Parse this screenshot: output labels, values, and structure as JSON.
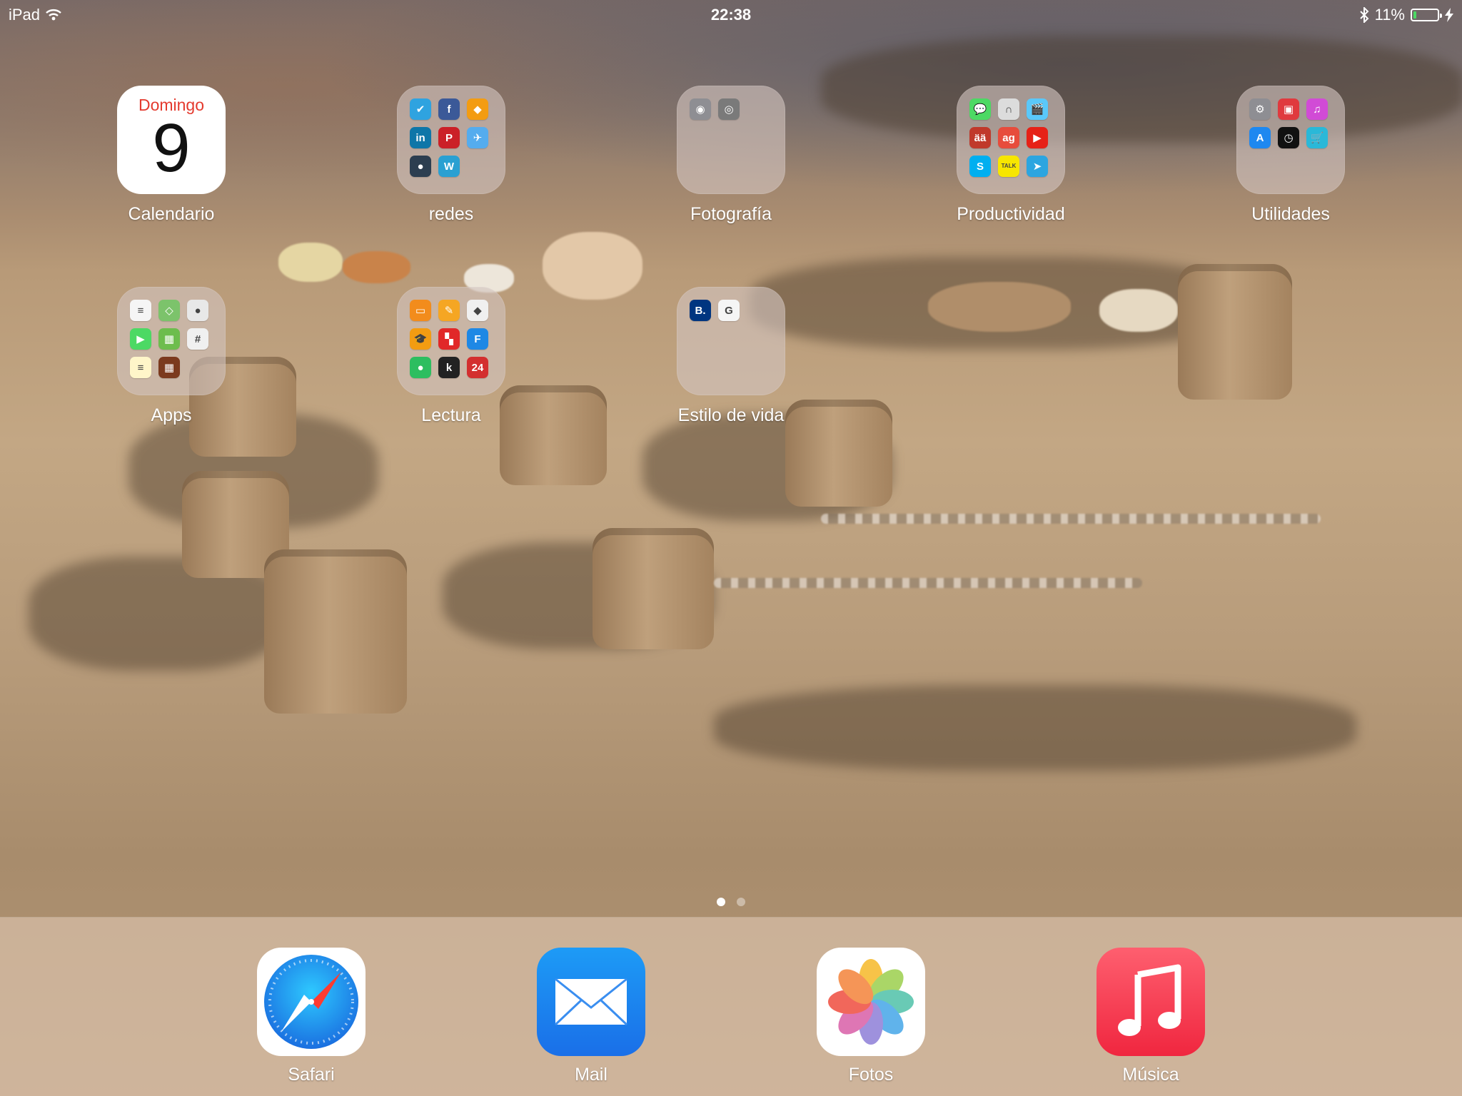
{
  "status_bar": {
    "device": "iPad",
    "time": "22:38",
    "battery_percent": "11%",
    "battery_level": 0.11,
    "icons": [
      "wifi-icon",
      "bluetooth-icon",
      "battery-icon",
      "charging-bolt-icon"
    ]
  },
  "home": {
    "row1": {
      "calendar": {
        "label": "Calendario",
        "weekday": "Domingo",
        "day": "9"
      },
      "redes": {
        "label": "redes"
      },
      "fotografia": {
        "label": "Fotografía"
      },
      "productividad": {
        "label": "Productividad"
      },
      "utilidades": {
        "label": "Utilidades"
      }
    },
    "row2": {
      "apps": {
        "label": "Apps"
      },
      "lectura": {
        "label": "Lectura"
      },
      "estilo": {
        "label": "Estilo de vida"
      }
    }
  },
  "folder_apps": {
    "redes": [
      {
        "icon": "tasks-app-icon",
        "color": "#2fa3e0",
        "glyph": "✔"
      },
      {
        "icon": "facebook-icon",
        "color": "#3b5998",
        "glyph": "f"
      },
      {
        "icon": "orange-app-icon",
        "color": "#f39c12",
        "glyph": "◆"
      },
      {
        "icon": "linkedin-icon",
        "color": "#0e76a8",
        "glyph": "in"
      },
      {
        "icon": "pinterest-icon",
        "color": "#cb2027",
        "glyph": "P"
      },
      {
        "icon": "twitter-icon",
        "color": "#55acee",
        "glyph": "✈"
      },
      {
        "icon": "tapbots-icon",
        "color": "#2c3e50",
        "glyph": "●"
      },
      {
        "icon": "wordpress-icon",
        "color": "#2aa0d2",
        "glyph": "W"
      }
    ],
    "fotografia": [
      {
        "icon": "camera-icon",
        "color": "#8e8e93",
        "glyph": "◉"
      },
      {
        "icon": "photo-booth-icon",
        "color": "#7a7a7a",
        "glyph": "◎"
      }
    ],
    "productividad": [
      {
        "icon": "messages-icon",
        "color": "#4cd964",
        "glyph": "💬"
      },
      {
        "icon": "headphones-app-icon",
        "color": "#dcdcdc",
        "glyph": "∩"
      },
      {
        "icon": "clapperboard-icon",
        "color": "#5ac8fa",
        "glyph": "🎬"
      },
      {
        "icon": "keyboard-app-icon",
        "color": "#c0392b",
        "glyph": "ää"
      },
      {
        "icon": "app-gratis-icon",
        "color": "#e74c3c",
        "glyph": "ag"
      },
      {
        "icon": "youtube-icon",
        "color": "#e62117",
        "glyph": "▶"
      },
      {
        "icon": "skype-icon",
        "color": "#00aff0",
        "glyph": "S"
      },
      {
        "icon": "kakaotalk-icon",
        "color": "#f7e600",
        "glyph": "TALK"
      },
      {
        "icon": "telegram-icon",
        "color": "#2ca5e0",
        "glyph": "➤"
      }
    ],
    "utilidades": [
      {
        "icon": "settings-icon",
        "color": "#8e8e93",
        "glyph": "⚙"
      },
      {
        "icon": "red-app-icon",
        "color": "#e03a3e",
        "glyph": "▣"
      },
      {
        "icon": "itunes-store-icon",
        "color": "#d14bd6",
        "glyph": "♫"
      },
      {
        "icon": "app-store-icon",
        "color": "#1e88f0",
        "glyph": "A"
      },
      {
        "icon": "clock-icon",
        "color": "#111111",
        "glyph": "◷"
      },
      {
        "icon": "shopping-cart-icon",
        "color": "#2ab8d8",
        "glyph": "🛒"
      }
    ],
    "apps": [
      {
        "icon": "reminders-icon",
        "color": "#f5f5f5",
        "glyph": "≡"
      },
      {
        "icon": "maps-icon",
        "color": "#7cc36b",
        "glyph": "◇"
      },
      {
        "icon": "game-center-icon",
        "color": "#e8e8e8",
        "glyph": "●"
      },
      {
        "icon": "facetime-icon",
        "color": "#4cd964",
        "glyph": "▶"
      },
      {
        "icon": "photos-app-icon",
        "color": "#6dbd4d",
        "glyph": "▦"
      },
      {
        "icon": "redes-2014-icon",
        "color": "#f0f0f0",
        "glyph": "#"
      },
      {
        "icon": "notes-icon",
        "color": "#fff6c9",
        "glyph": "≡"
      },
      {
        "icon": "photo-collage-icon",
        "color": "#7b3a1e",
        "glyph": "▦"
      }
    ],
    "lectura": [
      {
        "icon": "ibooks-icon",
        "color": "#f28c1c",
        "glyph": "▭"
      },
      {
        "icon": "pages-icon",
        "color": "#f5a623",
        "glyph": "✎"
      },
      {
        "icon": "feedly-icon",
        "color": "#f0f0f0",
        "glyph": "◆"
      },
      {
        "icon": "itunes-u-icon",
        "color": "#f39c12",
        "glyph": "🎓"
      },
      {
        "icon": "flipboard-icon",
        "color": "#e12828",
        "glyph": "▚"
      },
      {
        "icon": "f-app-icon",
        "color": "#1e88e5",
        "glyph": "F"
      },
      {
        "icon": "evernote-icon",
        "color": "#2dbe60",
        "glyph": "●"
      },
      {
        "icon": "kindle-icon",
        "color": "#222222",
        "glyph": "k"
      },
      {
        "icon": "news-24-icon",
        "color": "#d32f2f",
        "glyph": "24"
      }
    ],
    "estilo": [
      {
        "icon": "booking-icon",
        "color": "#003580",
        "glyph": "B."
      },
      {
        "icon": "g-app-icon",
        "color": "#f5f5f5",
        "glyph": "G"
      }
    ]
  },
  "page_indicator": {
    "pages": 2,
    "current": 1
  },
  "dock": {
    "safari": {
      "label": "Safari"
    },
    "mail": {
      "label": "Mail"
    },
    "fotos": {
      "label": "Fotos"
    },
    "musica": {
      "label": "Música"
    }
  },
  "colors": {
    "label_text": "#ffffff",
    "calendar_red": "#e43a2e",
    "battery_green": "#4cd964",
    "folder_bg": "rgba(210,195,190,0.62)",
    "dock_bg": "rgba(230,205,185,0.55)"
  }
}
